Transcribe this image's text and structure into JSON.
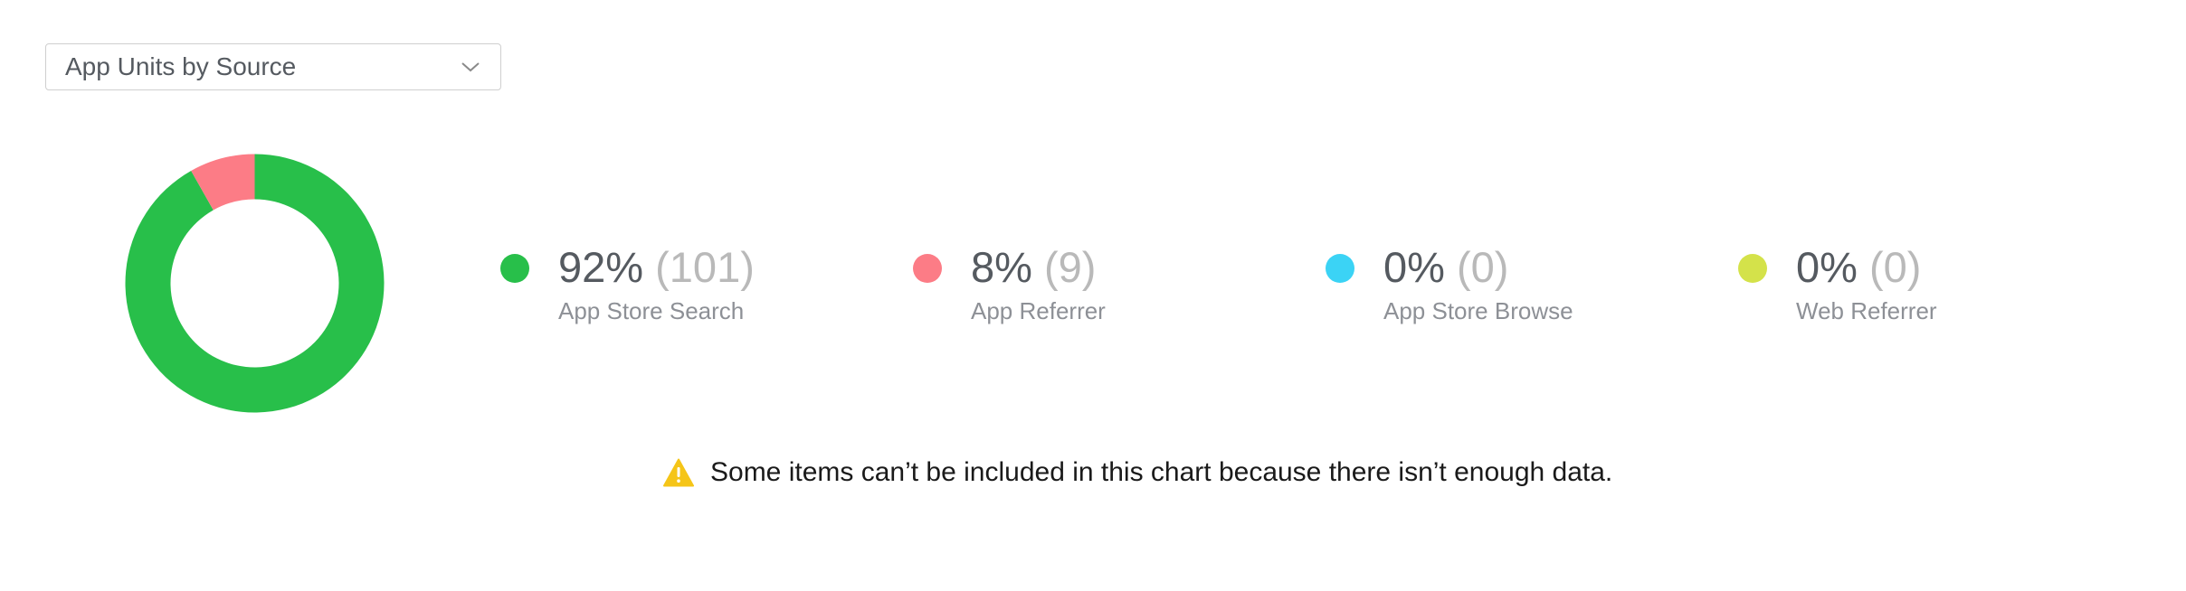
{
  "selector": {
    "label": "App Units by Source",
    "icon": "chevron-down-icon"
  },
  "chart_data": {
    "type": "pie",
    "style": "donut",
    "categories": [
      "App Store Search",
      "App Referrer",
      "App Store Browse",
      "Web Referrer"
    ],
    "values": [
      101,
      9,
      0,
      0
    ],
    "percentages": [
      92,
      8,
      0,
      0
    ],
    "colors": [
      "#28bf4a",
      "#fc7c86",
      "#3bd3f5",
      "#d4e24a"
    ],
    "legend_placement": "right"
  },
  "legend": [
    {
      "percent": "92%",
      "count": "(101)",
      "label": "App Store Search",
      "color": "#28bf4a"
    },
    {
      "percent": "8%",
      "count": "(9)",
      "label": "App Referrer",
      "color": "#fc7c86"
    },
    {
      "percent": "0%",
      "count": "(0)",
      "label": "App Store Browse",
      "color": "#3bd3f5"
    },
    {
      "percent": "0%",
      "count": "(0)",
      "label": "Web Referrer",
      "color": "#d4e24a"
    }
  ],
  "notice": {
    "icon": "warning-icon",
    "icon_color": "#f5c518",
    "text": "Some items can’t be included in this chart because there isn’t enough data."
  }
}
